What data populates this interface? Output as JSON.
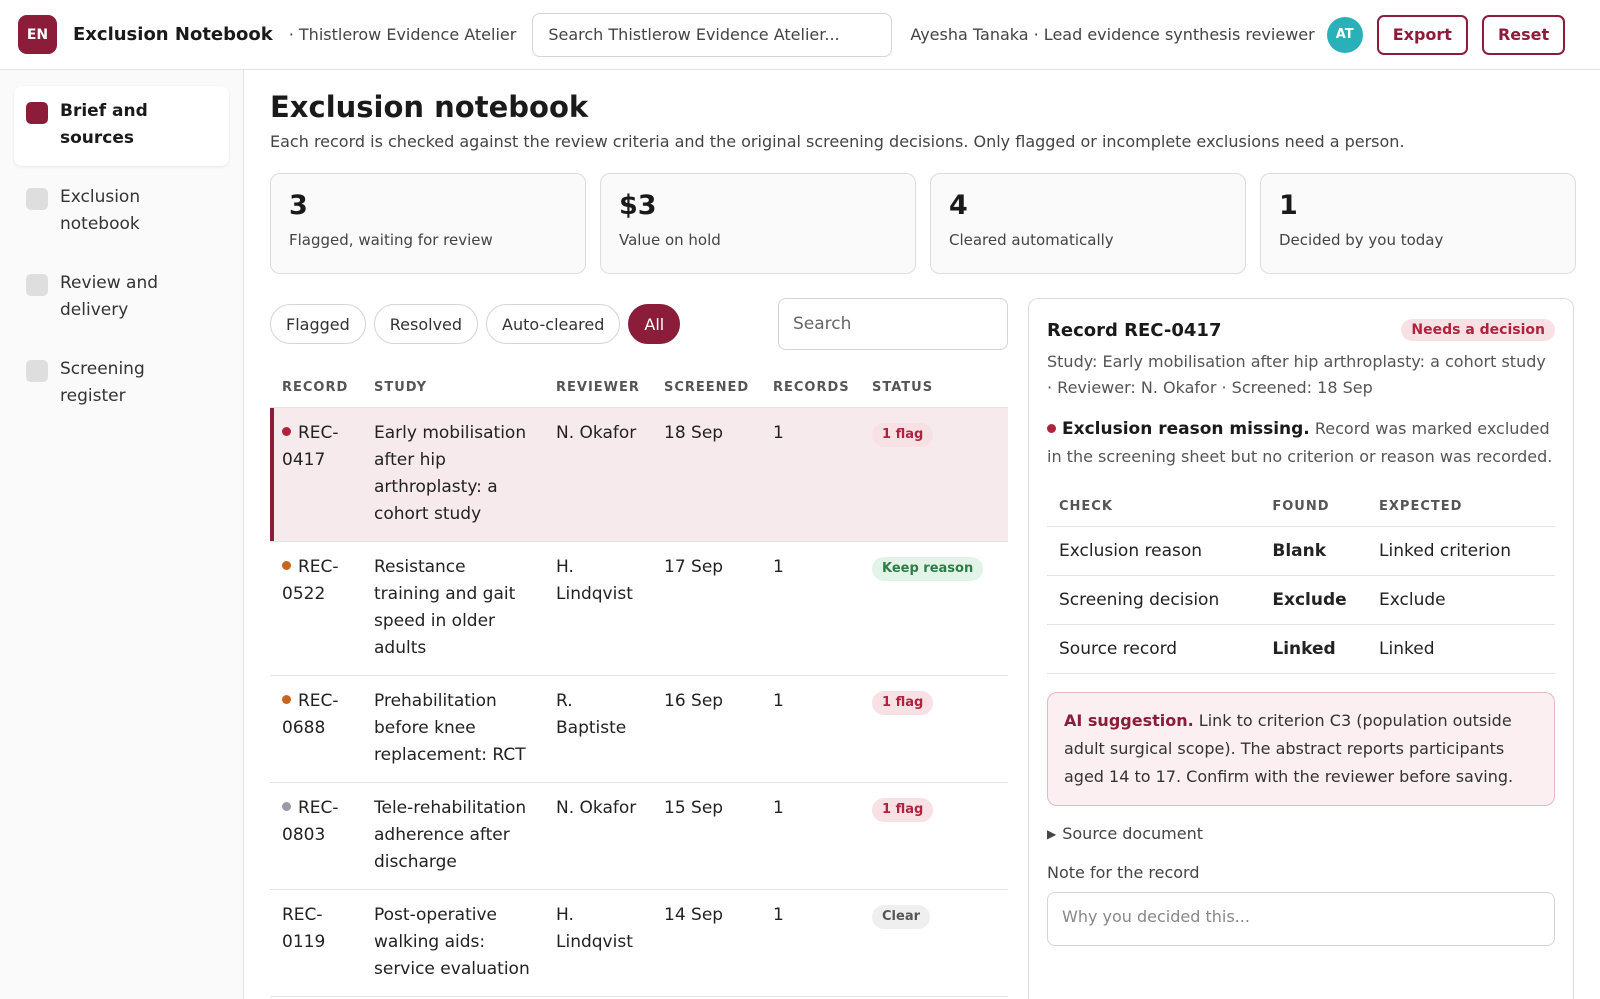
{
  "app": {
    "logo": "EN",
    "title": "Exclusion Notebook",
    "workspace": "· Thistlerow Evidence Atelier",
    "search_placeholder": "Search Thistlerow Evidence Atelier...",
    "user": "Ayesha Tanaka · Lead evidence synthesis reviewer",
    "avatar": "AT",
    "export_label": "Export",
    "reset_label": "Reset",
    "accent": "#8b1d3a"
  },
  "sidebar": {
    "items": [
      {
        "label": "Brief and sources",
        "active": true
      },
      {
        "label": "Exclusion notebook",
        "active": false
      },
      {
        "label": "Review and delivery",
        "active": false
      },
      {
        "label": "Screening register",
        "active": false
      }
    ]
  },
  "page": {
    "title": "Exclusion notebook",
    "subtitle": "Each record is checked against the review criteria and the original screening decisions. Only flagged or incomplete exclusions need a person."
  },
  "stats": [
    {
      "value": "3",
      "label": "Flagged, waiting for review"
    },
    {
      "value": "$3",
      "label": "Value on hold"
    },
    {
      "value": "4",
      "label": "Cleared automatically"
    },
    {
      "value": "1",
      "label": "Decided by you today"
    }
  ],
  "filters": {
    "chips": [
      "Flagged",
      "Resolved",
      "Auto-cleared",
      "All"
    ],
    "active": "All",
    "search_placeholder": "Search"
  },
  "table": {
    "headers": [
      "RECORD",
      "STUDY",
      "REVIEWER",
      "SCREENED",
      "RECORDS",
      "STATUS"
    ],
    "rows": [
      {
        "record": "REC-0417",
        "study": "Early mobilisation after hip arthroplasty: a cohort study",
        "reviewer": "N. Okafor",
        "screened": "18 Sep",
        "records": "1",
        "status": "1 flag",
        "status_kind": "flag",
        "dot": "#b0233f",
        "selected": true
      },
      {
        "record": "REC-0522",
        "study": "Resistance training and gait speed in older adults",
        "reviewer": "H. Lindqvist",
        "screened": "17 Sep",
        "records": "1",
        "status": "Keep reason",
        "status_kind": "keep",
        "dot": "#c8641e",
        "selected": false
      },
      {
        "record": "REC-0688",
        "study": "Prehabilitation before knee replacement: RCT",
        "reviewer": "R. Baptiste",
        "screened": "16 Sep",
        "records": "1",
        "status": "1 flag",
        "status_kind": "flag",
        "dot": "#c8641e",
        "selected": false
      },
      {
        "record": "REC-0803",
        "study": "Tele-rehabilitation adherence after discharge",
        "reviewer": "N. Okafor",
        "screened": "15 Sep",
        "records": "1",
        "status": "1 flag",
        "status_kind": "flag",
        "dot": "#9a9aa6",
        "selected": false
      },
      {
        "record": "REC-0119",
        "study": "Post-operative walking aids: service evaluation",
        "reviewer": "H. Lindqvist",
        "screened": "14 Sep",
        "records": "1",
        "status": "Clear",
        "status_kind": "clear",
        "dot": "",
        "selected": false
      }
    ]
  },
  "detail": {
    "title": "Record REC-0417",
    "badge": "Needs a decision",
    "meta": "Study: Early mobilisation after hip arthroplasty: a cohort study · Reviewer: N. Okafor · Screened: 18 Sep",
    "issue_title": "Exclusion reason missing.",
    "issue_text": "Record was marked excluded in the screening sheet but no criterion or reason was recorded.",
    "checks_headers": [
      "CHECK",
      "FOUND",
      "EXPECTED"
    ],
    "checks": [
      {
        "check": "Exclusion reason",
        "found": "Blank",
        "expected": "Linked criterion",
        "ok": false
      },
      {
        "check": "Screening decision",
        "found": "Exclude",
        "expected": "Exclude",
        "ok": true
      },
      {
        "check": "Source record",
        "found": "Linked",
        "expected": "Linked",
        "ok": true
      }
    ],
    "ai_label": "AI suggestion.",
    "ai_text": "Link to criterion C3 (population outside adult surgical scope). The abstract reports participants aged 14 to 17. Confirm with the reviewer before saving.",
    "source_doc_label": "Source document",
    "note_label": "Note for the record",
    "note_placeholder": "Why you decided this..."
  }
}
